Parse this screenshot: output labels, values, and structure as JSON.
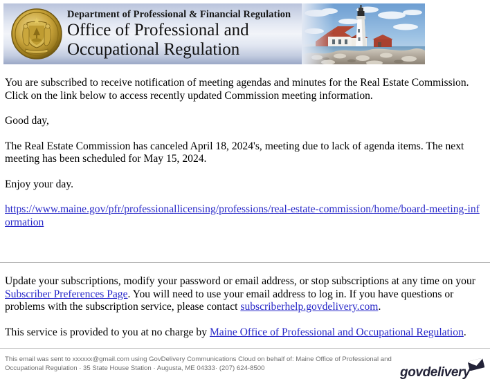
{
  "banner": {
    "seal_alt": "maine-state-seal",
    "department_line": "Department of Professional & Financial Regulation",
    "office_line_1": "Office of Professional and",
    "office_line_2": "Occupational Regulation",
    "photo_alt": "portland-head-lighthouse-photo",
    "colors": {
      "banner_gradient_light": "#f2f4f9",
      "banner_gradient_dark": "#9aa7c6",
      "seal_gold": "#b99329"
    }
  },
  "body": {
    "intro": "You are subscribed to receive notification of meeting agendas and minutes for the Real Estate Commission. Click on the link below to access recently updated Commission meeting information.",
    "greeting": "Good day,",
    "announcement": "The Real Estate Commission has canceled April 18, 2024's, meeting due to lack of agenda items. The next meeting has been scheduled for May 15, 2024.",
    "closing": "Enjoy your day.",
    "meeting_link_text": "https://www.maine.gov/pfr/professionallicensing/professions/real-estate-commission/home/board-meeting-information"
  },
  "subscription": {
    "line1_before_link": "Update your subscriptions, modify your password or email address, or stop subscriptions at any time on your ",
    "preferences_link": "Subscriber Preferences Page",
    "line1_after_link": ". You will need to use your email address to log in. If you have questions or problems with the subscription service, please contact ",
    "help_email_link": "subscriberhelp.govdelivery.com",
    "line1_end": ".",
    "no_charge_before": "This service is provided to you at no charge by ",
    "no_charge_link": "Maine Office of Professional and Occupational Regulation",
    "no_charge_end": ".",
    "link_color": "#2828c8"
  },
  "footer": {
    "line1": "This email was sent to xxxxxx@gmail.com using GovDelivery Communications Cloud on behalf of: Maine Office of Professional and",
    "line2": "Occupational Regulation · 35 State House Station · Augusta, ME 04333· (207) 624-8500",
    "logo_wordmark": "govdelivery",
    "logo_envelope_alt": "envelope-icon",
    "text_color": "#6d6d6d"
  }
}
